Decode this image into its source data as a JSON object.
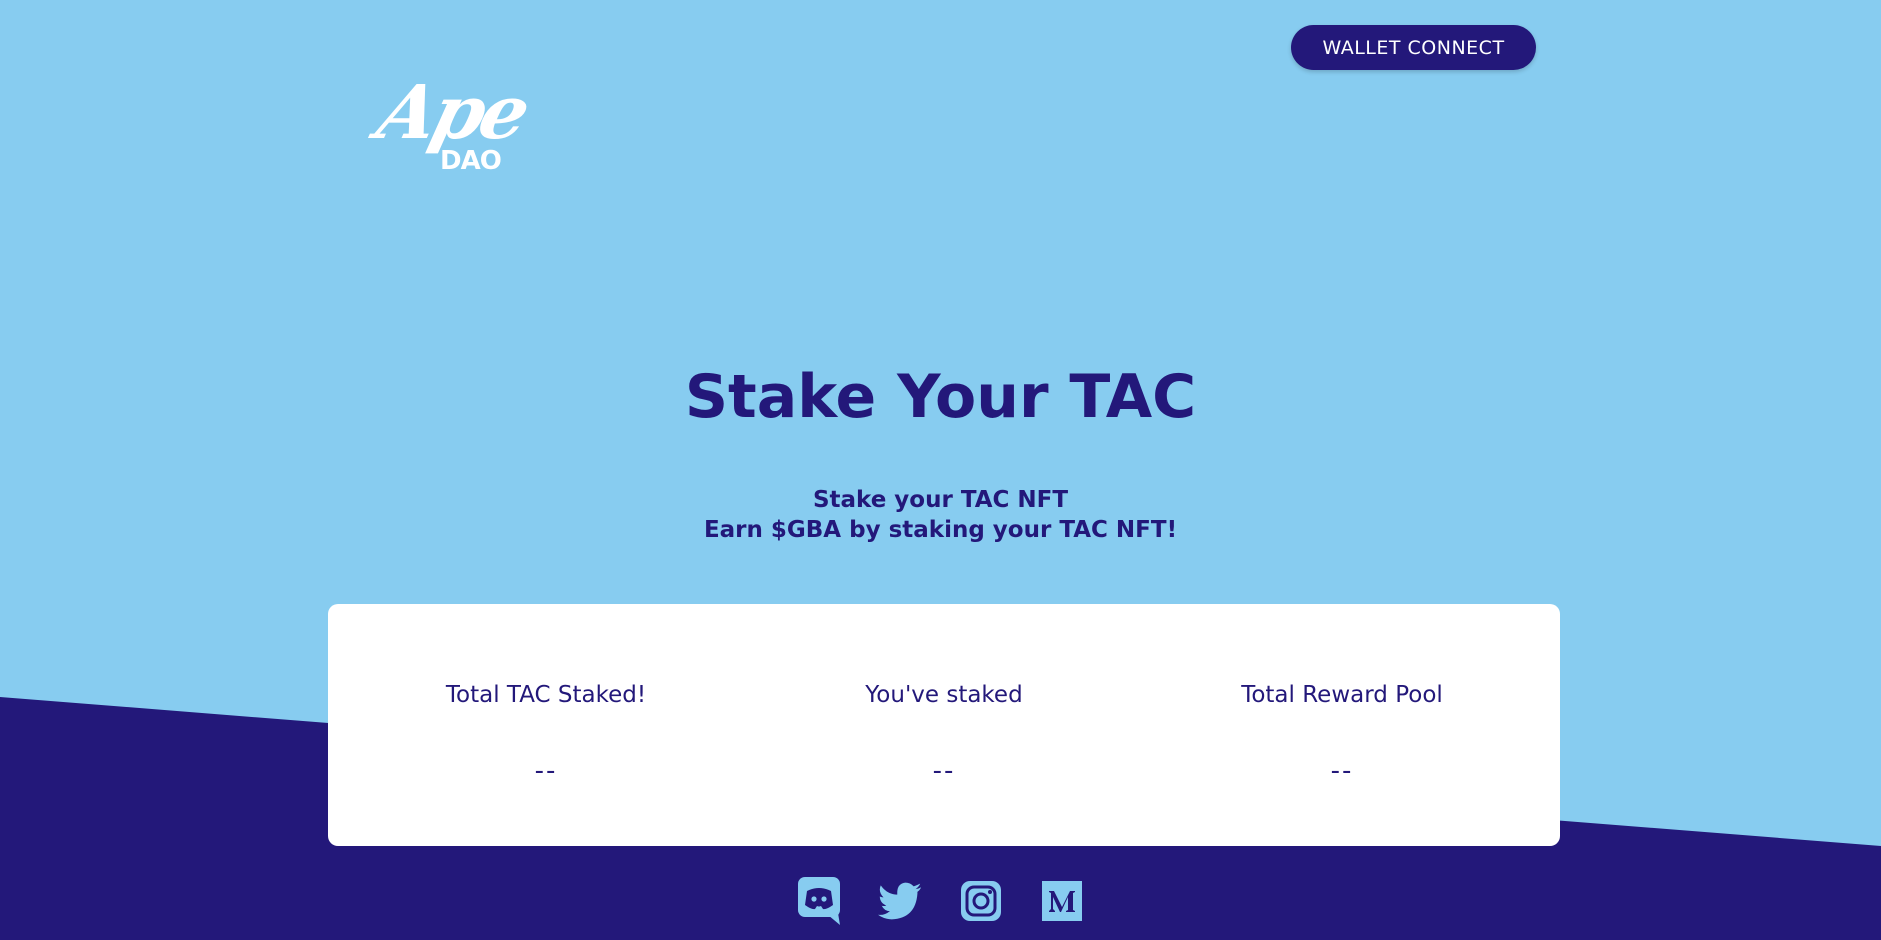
{
  "header": {
    "wallet_button_label": "WALLET CONNECT",
    "logo": {
      "primary": "Ape",
      "secondary": "DAO"
    }
  },
  "hero": {
    "title": "Stake Your TAC",
    "subtitle_line1": "Stake your TAC NFT",
    "subtitle_line2": "Earn $GBA by staking your TAC NFT!"
  },
  "stats": [
    {
      "label": "Total TAC Staked!",
      "value": "--"
    },
    {
      "label": "You've staked",
      "value": "--"
    },
    {
      "label": "Total Reward Pool",
      "value": "--"
    }
  ],
  "footer": {
    "social_icons": [
      "discord-icon",
      "twitter-icon",
      "instagram-icon",
      "medium-icon"
    ]
  },
  "colors": {
    "background_light": "#87ccf0",
    "background_dark": "#23187a",
    "accent": "#23187a",
    "card": "#ffffff"
  }
}
